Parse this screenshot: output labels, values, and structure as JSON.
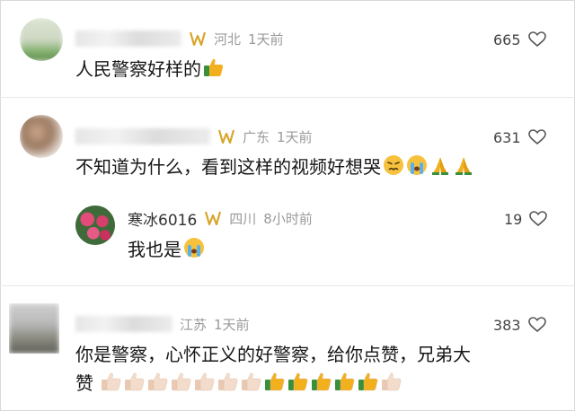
{
  "comments": [
    {
      "region": "河北",
      "time": "1天前",
      "likes": "665",
      "text": "人民警察好样的",
      "emoji": "thumbs-up-icon"
    },
    {
      "region": "广东",
      "time": "1天前",
      "likes": "631",
      "text": "不知道为什么，看到这样的视频好想哭",
      "emoji": [
        "persevering-face-icon",
        "crying-face-icon",
        "folded-hands-icon",
        "folded-hands-icon"
      ],
      "reply": {
        "name": "寒冰6016",
        "region": "四川",
        "time": "8小时前",
        "likes": "19",
        "text": "我也是",
        "emoji": "crying-face-icon"
      }
    },
    {
      "region": "江苏",
      "time": "1天前",
      "likes": "383",
      "text_line1": "你是警察，心怀正义的好警察，给你点赞，兄弟大",
      "text_line2": "赞",
      "emoji": [
        "thumbs-up-light-icon",
        "thumbs-up-light-icon",
        "thumbs-up-light-icon",
        "thumbs-up-light-icon",
        "thumbs-up-light-icon",
        "thumbs-up-light-icon",
        "thumbs-up-light-icon",
        "thumbs-up-icon",
        "thumbs-up-icon",
        "thumbs-up-icon",
        "thumbs-up-icon",
        "thumbs-up-icon",
        "thumbs-up-light-icon"
      ]
    }
  ],
  "colors": {
    "badge": "#d8a52a",
    "thumb_gold": "#f2b01e",
    "thumb_light": "#f3dccb",
    "sleeve": "#3a8f3a"
  }
}
